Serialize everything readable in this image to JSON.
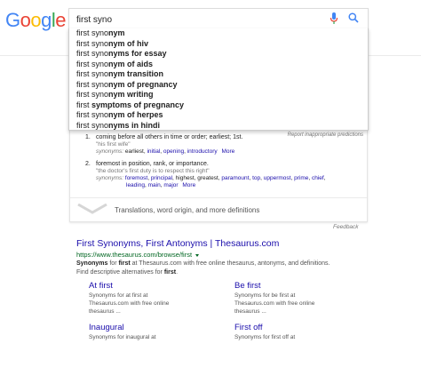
{
  "search": {
    "query": "first syno",
    "placeholder": ""
  },
  "suggestions": [
    {
      "prefix": "first syno",
      "rest": "nym"
    },
    {
      "prefix": "first syno",
      "rest": "nym of hiv"
    },
    {
      "prefix": "first syno",
      "rest": "nyms for essay"
    },
    {
      "prefix": "first syno",
      "rest": "nym of aids"
    },
    {
      "prefix": "first syno",
      "rest": "nym transition"
    },
    {
      "prefix": "first syno",
      "rest": "nym of pregnancy"
    },
    {
      "prefix": "first syno",
      "rest": "nym writing"
    },
    {
      "prefix": "first ",
      "rest": "symptoms of pregnancy"
    },
    {
      "prefix": "first syno",
      "rest": "nym of herpes"
    },
    {
      "prefix": "first syno",
      "rest": "nyms in hindi"
    }
  ],
  "dictionary": {
    "report": "Report inappropriate predictions",
    "definitions": [
      {
        "num": "1.",
        "text": "coming before all others in time or order; earliest; 1st.",
        "example": "\"his first wife\"",
        "syn_label": "synonyms:",
        "synonyms_plain": [
          "earliest"
        ],
        "synonyms_links": [
          "initial",
          "opening",
          "introductory"
        ],
        "more": "More"
      },
      {
        "num": "2.",
        "text": "foremost in position, rank, or importance.",
        "example": "\"the doctor's first duty is to respect this right\"",
        "syn_label": "synonyms:",
        "synonyms_row1": [
          "foremost",
          "principal",
          "highest",
          "greatest",
          "paramount",
          "top",
          "uppermost",
          "prime",
          "chief"
        ],
        "synonyms_row2": [
          "leading",
          "main",
          "major"
        ],
        "more": "More"
      }
    ],
    "more_defs": "Translations, word origin, and more definitions"
  },
  "feedback": "Feedback",
  "result": {
    "title": "First Synonyms, First Antonyms | Thesaurus.com",
    "url": "https://www.thesaurus.com/browse/first",
    "snippet_b1": "Synonyms",
    "snippet_t1": " for ",
    "snippet_b2": "first",
    "snippet_t2": " at Thesaurus.com with free online thesaurus, antonyms, and definitions. Find descriptive alternatives for ",
    "snippet_b3": "first",
    "snippet_t3": "."
  },
  "sublinks": [
    {
      "title": "At first",
      "snippet": "Synonyms for at first at Thesaurus.com with free online thesaurus ..."
    },
    {
      "title": "Be first",
      "snippet": "Synonyms for be first at Thesaurus.com with free online thesaurus ..."
    },
    {
      "title": "Inaugural",
      "snippet": "Synonyms for inaugural at"
    },
    {
      "title": "First off",
      "snippet": "Synonyms for first off at"
    }
  ],
  "colors": {
    "link": "#1a0dab",
    "url": "#006621",
    "google_blue": "#4285f4",
    "google_red": "#ea4335",
    "google_yellow": "#fbbc05",
    "google_green": "#34a853"
  }
}
